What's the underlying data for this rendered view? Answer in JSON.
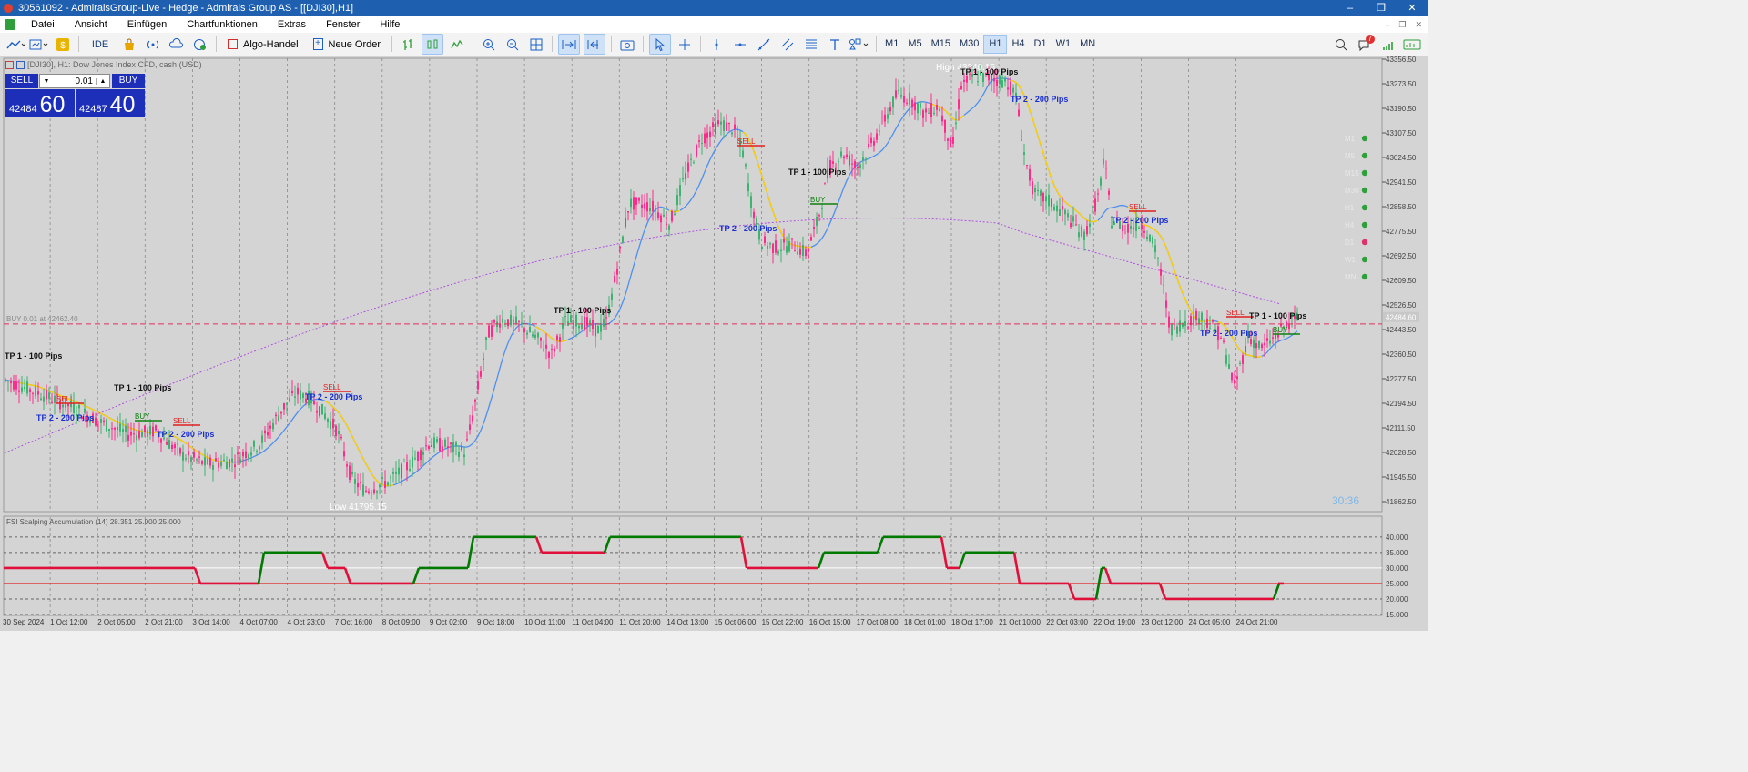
{
  "window": {
    "title": "30561092 - AdmiralsGroup-Live - Hedge - Admirals Group AS - [[DJI30],H1]",
    "controls": [
      "–",
      "❐",
      "✕"
    ]
  },
  "menu": [
    "Datei",
    "Ansicht",
    "Einfügen",
    "Chartfunktionen",
    "Extras",
    "Fenster",
    "Hilfe"
  ],
  "toolbar": {
    "ide_label": "IDE",
    "algo_label": "Algo-Handel",
    "new_order_label": "Neue Order",
    "timeframes": [
      "M1",
      "M5",
      "M15",
      "M30",
      "H1",
      "H4",
      "D1",
      "W1",
      "MN"
    ],
    "active_timeframe": "H1",
    "notification_count": "7"
  },
  "chart": {
    "symbol_line": "[DJI30], H1:  Dow Jones Index CFD, cash (USD)",
    "trade_panel": {
      "sell_label": "SELL",
      "buy_label": "BUY",
      "volume": "0.01",
      "sell_price_small": "42484",
      "sell_price_big": "60",
      "buy_price_small": "42487",
      "buy_price_big": "40"
    },
    "high_label": "High 43340.15",
    "low_label": "Low 41795.15",
    "position_line_label": "BUY 0.01 at 42462.40",
    "current_price_tag": "42484.60",
    "countdown": "30:36",
    "price_axis": [
      "43356.50",
      "43273.50",
      "43190.50",
      "43107.50",
      "43024.50",
      "42941.50",
      "42858.50",
      "42775.50",
      "42692.50",
      "42609.50",
      "42526.50",
      "42443.50",
      "42360.50",
      "42277.50",
      "42194.50",
      "42111.50",
      "42028.50",
      "41945.50",
      "41862.50"
    ],
    "time_axis": [
      "30 Sep 2024",
      "1 Oct 12:00",
      "2 Oct 05:00",
      "2 Oct 21:00",
      "3 Oct 14:00",
      "4 Oct 07:00",
      "4 Oct 23:00",
      "7 Oct 16:00",
      "8 Oct 09:00",
      "9 Oct 02:00",
      "9 Oct 18:00",
      "10 Oct 11:00",
      "11 Oct 04:00",
      "11 Oct 20:00",
      "14 Oct 13:00",
      "15 Oct 06:00",
      "15 Oct 22:00",
      "16 Oct 15:00",
      "17 Oct 08:00",
      "18 Oct 01:00",
      "18 Oct 17:00",
      "21 Oct 10:00",
      "22 Oct 03:00",
      "22 Oct 19:00",
      "23 Oct 12:00",
      "24 Oct 05:00",
      "24 Oct 21:00"
    ],
    "tf_panel_labels": [
      "M1",
      "M5",
      "M15",
      "M30",
      "H1",
      "H4",
      "D1",
      "W1",
      "MN"
    ],
    "signal_labels": {
      "sell": "SELL",
      "buy": "BUY",
      "tp_pips": "TP 1 - 100 Pips",
      "tp_pips2": "TP 2 - 200 Pips"
    },
    "indicator": {
      "title": "FSI Scalping Accumulation (14) 28.351 25.000 25.000",
      "levels": [
        "40.000",
        "35.000",
        "30.000",
        "25.000",
        "20.000",
        "15.000"
      ]
    },
    "colors": {
      "background": "#d4d4d4",
      "bull": "#3cb371",
      "bear": "#ff2b8a",
      "ma_fast": "#4f8ff0",
      "ma_fast_alt": "#ffd000",
      "ma_slow": "#b050e0",
      "osc_up": "#007a00",
      "osc_down": "#e0103a"
    }
  }
}
